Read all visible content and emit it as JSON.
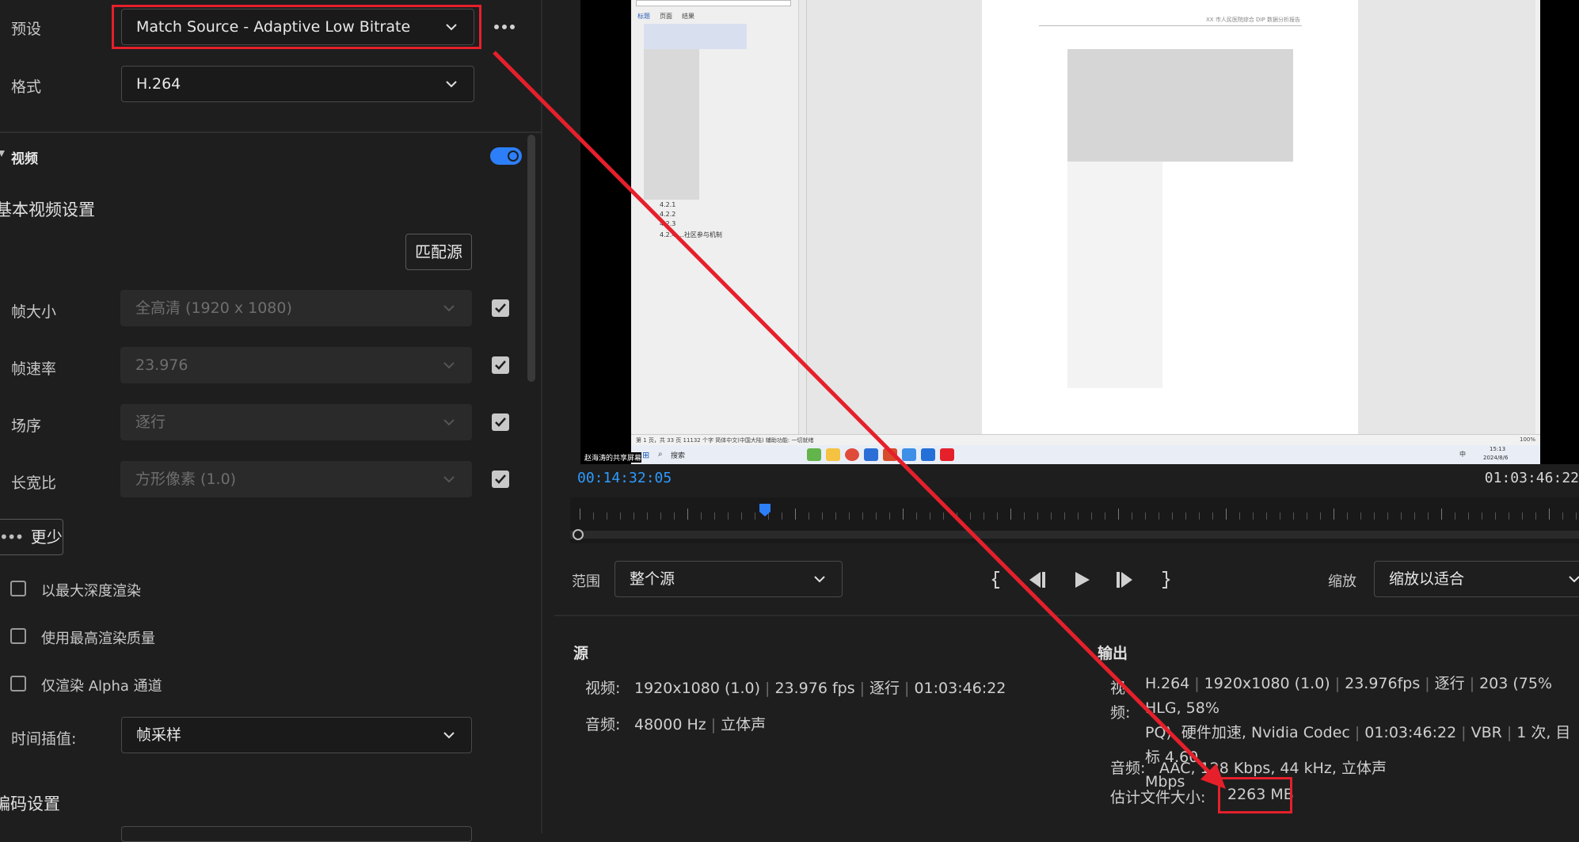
{
  "export": {
    "preset_label": "预设",
    "preset_value": "Match Source - Adaptive Low Bitrate",
    "format_label": "格式",
    "format_value": "H.264",
    "video_section_label": "视频",
    "basic_video_settings_label": "基本视频设置",
    "match_source_button": "匹配源",
    "frame_size_label": "帧大小",
    "frame_size_value": "全高清 (1920 x 1080)",
    "frame_rate_label": "帧速率",
    "frame_rate_value": "23.976",
    "field_order_label": "场序",
    "field_order_value": "逐行",
    "aspect_label": "长宽比",
    "aspect_value": "方形像素 (1.0)",
    "less_button": "更少",
    "max_depth_label": "以最大深度渲染",
    "max_quality_label": "使用最高渲染质量",
    "alpha_only_label": "仅渲染 Alpha 通道",
    "time_interp_label": "时间插值:",
    "time_interp_value": "帧采样",
    "encoding_settings_label": "编码设置"
  },
  "preview": {
    "doc_tab_1": "标题",
    "doc_tab_2": "页面",
    "doc_tab_3": "结果",
    "outline_1": "4.2.1",
    "outline_2": "4.2.2",
    "outline_3": "4.2.3",
    "outline_4": "4.2.4 …社区参与机制",
    "doc_header_text": "XX 市人民医院综合 DIP 数据分析报告",
    "statusbar_text": "第 1 页，共 33 页    11132 个字    简体中文(中国大陆)    辅助功能: 一切就绪",
    "statusbar_zoom": "100%",
    "screen_share_label": "赵海涛的共享屏幕",
    "taskbar_search": "搜索",
    "taskbar_time": "15:13",
    "taskbar_date": "2024/8/6",
    "taskbar_lang": "中"
  },
  "timeline": {
    "current_time": "00:14:32:05",
    "end_time": "01:03:46:22",
    "playhead_fraction": 0.18
  },
  "transport": {
    "range_label": "范围",
    "range_value": "整个源",
    "zoom_label": "缩放",
    "zoom_value": "缩放以适合"
  },
  "source_info": {
    "title": "源",
    "video_label": "视频:",
    "video_res": "1920x1080 (1.0)",
    "video_fps": "23.976 fps",
    "video_field": "逐行",
    "video_duration": "01:03:46:22",
    "audio_label": "音频:",
    "audio_rate": "48000 Hz",
    "audio_channels": "立体声"
  },
  "output_info": {
    "title": "输出",
    "video_label_1": "视",
    "video_label_2": "频:",
    "video_codec": "H.264",
    "video_res": "1920x1080 (1.0)",
    "video_fps": "23.976fps",
    "video_field": "逐行",
    "video_detail_1": "203 (75% HLG, 58%",
    "video_detail_2": "PQ), 硬件加速, Nvidia Codec",
    "video_duration": "01:03:46:22",
    "video_vbr": "VBR",
    "video_pass": "1 次, 目标 4.60",
    "video_mbps": "Mbps",
    "audio_label": "音频:",
    "audio_value": "AAC, 128 Kbps, 44 kHz, 立体声",
    "size_label": "估计文件大小:",
    "size_value": "2263 MB"
  },
  "colors": {
    "accent_blue": "#2d7ff9",
    "annotation_red": "#e5202b",
    "panel_bg": "#1e1e1e"
  }
}
